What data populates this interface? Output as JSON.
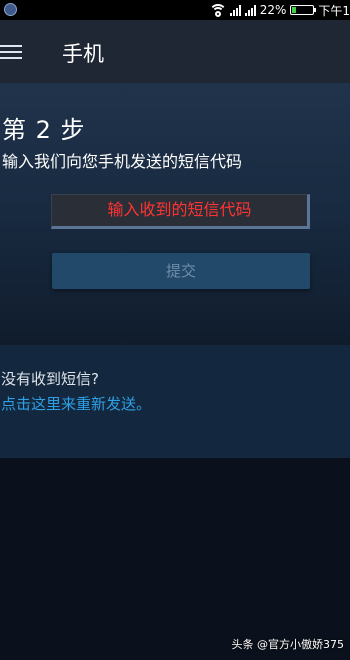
{
  "status_bar": {
    "battery_percent_text": "22%",
    "battery_level": 0.22,
    "time_text": "下午1"
  },
  "header": {
    "title": "手机"
  },
  "step": {
    "title": "第 2 步",
    "description": "输入我们向您手机发送的短信代码"
  },
  "code_input": {
    "placeholder": "输入收到的短信代码",
    "value": ""
  },
  "submit_button": {
    "label": "提交"
  },
  "resend": {
    "question": "没有收到短信?",
    "link_text": "点击这里来重新发送。"
  },
  "watermark": {
    "text": "头条 @官方小傲娇375"
  },
  "colors": {
    "placeholder_red": "#ff3333",
    "link_blue": "#2ea0e6",
    "submit_bg": "#22486a"
  }
}
